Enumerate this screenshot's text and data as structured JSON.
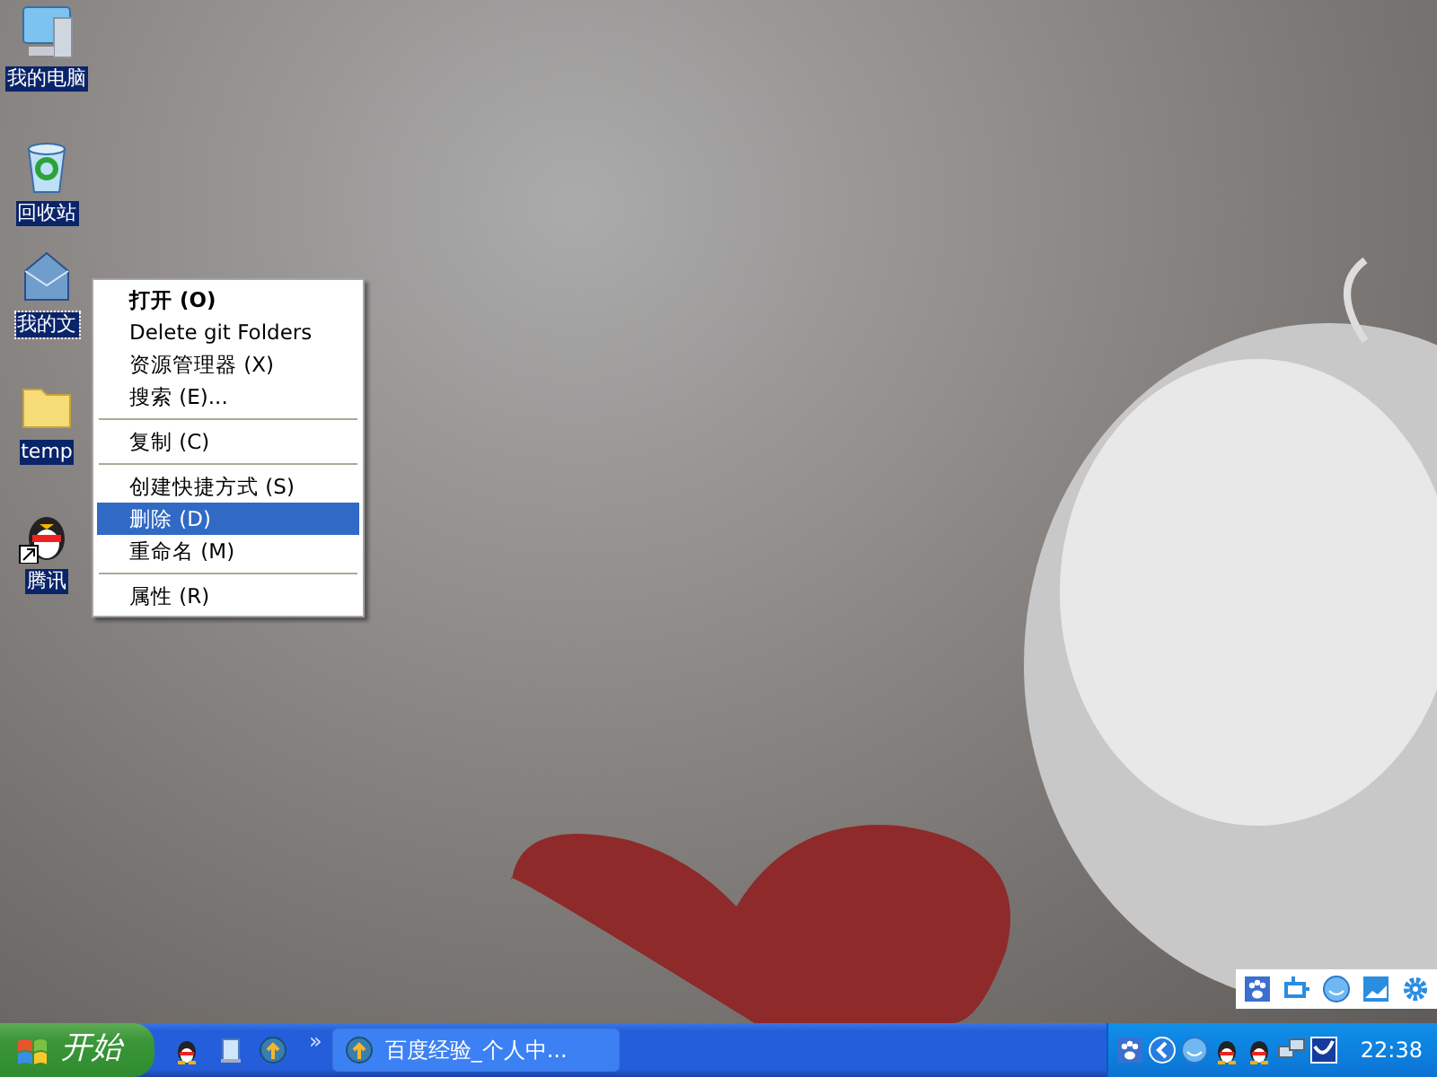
{
  "desktop_icons": [
    {
      "label": "我的电脑",
      "kind": "computer",
      "selected": false
    },
    {
      "label": "回收站",
      "kind": "recycle",
      "selected": false
    },
    {
      "label": "我的文",
      "kind": "documents",
      "selected": true
    },
    {
      "label": "temp",
      "kind": "folder",
      "selected": false
    },
    {
      "label": "腾讯",
      "kind": "qq",
      "selected": false
    }
  ],
  "context_menu": {
    "items": [
      {
        "kind": "item",
        "label": "打开 (O)",
        "default": true,
        "selected": false
      },
      {
        "kind": "item",
        "label": "Delete git Folders",
        "default": false,
        "selected": false
      },
      {
        "kind": "item",
        "label": "资源管理器 (X)",
        "default": false,
        "selected": false
      },
      {
        "kind": "item",
        "label": "搜索 (E)...",
        "default": false,
        "selected": false
      },
      {
        "kind": "separator"
      },
      {
        "kind": "item",
        "label": "复制 (C)",
        "default": false,
        "selected": false
      },
      {
        "kind": "separator"
      },
      {
        "kind": "item",
        "label": "创建快捷方式 (S)",
        "default": false,
        "selected": false
      },
      {
        "kind": "item",
        "label": "删除 (D)",
        "default": false,
        "selected": true
      },
      {
        "kind": "item",
        "label": "重命名 (M)",
        "default": false,
        "selected": false
      },
      {
        "kind": "separator"
      },
      {
        "kind": "item",
        "label": "属性 (R)",
        "default": false,
        "selected": false
      }
    ]
  },
  "taskbar": {
    "start_label": "开始",
    "chevron": "»",
    "tasks": [
      {
        "label": "百度经验_个人中...",
        "selected": false
      }
    ],
    "tray": {
      "clock": "22:38"
    }
  }
}
